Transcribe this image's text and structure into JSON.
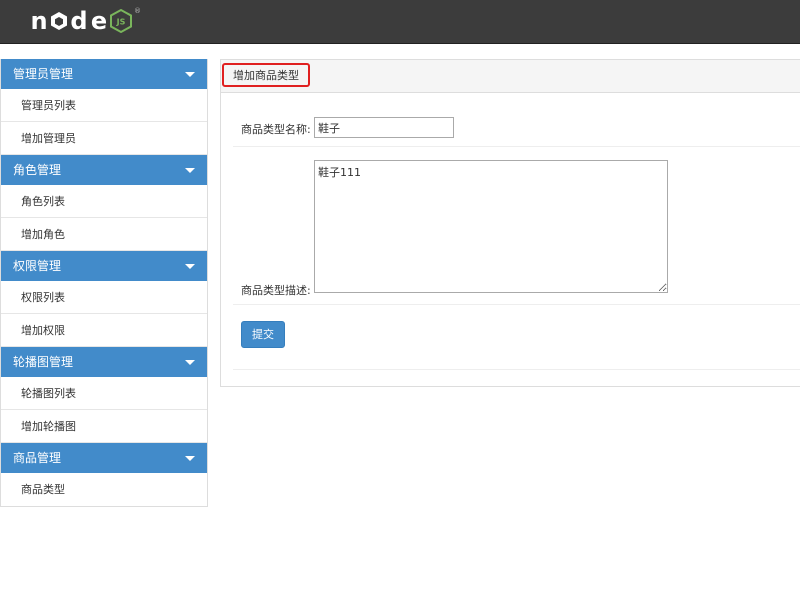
{
  "header": {
    "logo_letters": [
      "n",
      "o",
      "d",
      "e"
    ],
    "logo_badge": "JS",
    "logo_mark": "®"
  },
  "colors": {
    "header_bg": "#3c3c3c",
    "accent": "#428bca",
    "highlight_border": "#e02020",
    "node_green": "#7ab55c"
  },
  "sidebar": {
    "groups": [
      {
        "label": "管理员管理",
        "items": [
          "管理员列表",
          "增加管理员"
        ]
      },
      {
        "label": "角色管理",
        "items": [
          "角色列表",
          "增加角色"
        ]
      },
      {
        "label": "权限管理",
        "items": [
          "权限列表",
          "增加权限"
        ]
      },
      {
        "label": "轮播图管理",
        "items": [
          "轮播图列表",
          "增加轮播图"
        ]
      },
      {
        "label": "商品管理",
        "items": [
          "商品类型"
        ]
      }
    ]
  },
  "main": {
    "title": "增加商品类型",
    "form": {
      "name_label": "商品类型名称:",
      "name_value": "鞋子",
      "desc_label": "商品类型描述:",
      "desc_value": "鞋子111",
      "submit_label": "提交"
    }
  }
}
